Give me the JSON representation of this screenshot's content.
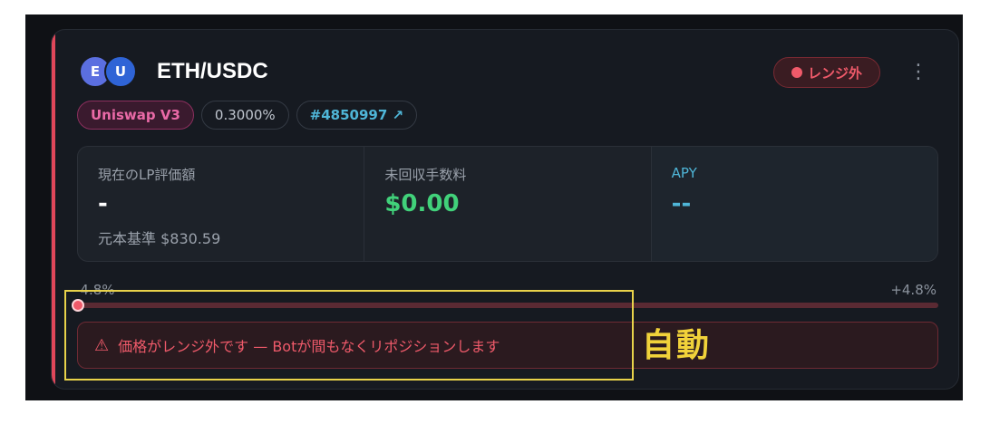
{
  "pool": {
    "token_a_initial": "E",
    "token_b_initial": "U",
    "pair": "ETH/USDC",
    "status_label": "レンジ外",
    "tags": {
      "dex": "Uniswap V3",
      "fee": "0.3000%",
      "position_id": "#4850997 ↗"
    }
  },
  "metrics": {
    "lp_value_label": "現在のLP評価額",
    "lp_value": "-",
    "principal_basis": "元本基準 $830.59",
    "unclaimed_fees_label": "未回収手数料",
    "unclaimed_fees": "$0.00",
    "apy_label": "APY",
    "apy_value": "--"
  },
  "range": {
    "min_label": "-4.8%",
    "max_label": "+4.8%"
  },
  "alert": {
    "icon": "warning-icon",
    "message": "価格がレンジ外です — Botが間もなくリポジションします"
  },
  "annotation": {
    "text": "自動"
  },
  "colors": {
    "accent_red": "#e0475a",
    "green": "#41d17a",
    "cyan": "#4fb6d8",
    "annotation_yellow": "#f1d23a"
  }
}
